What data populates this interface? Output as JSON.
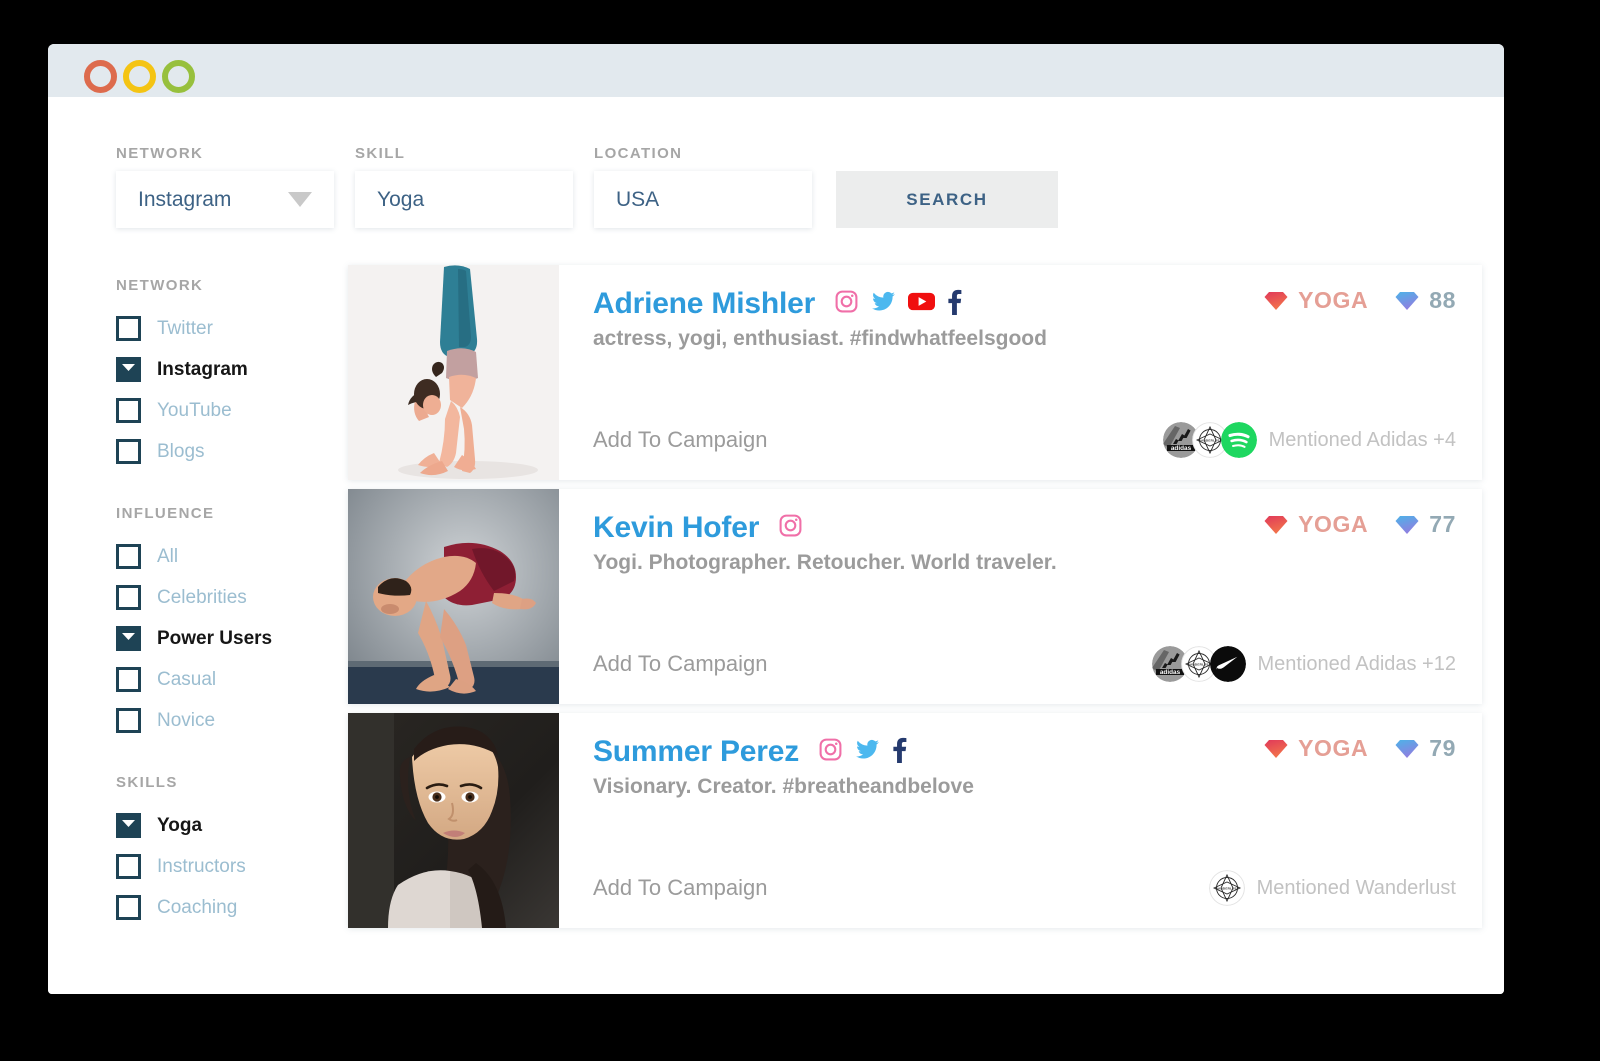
{
  "window": {
    "traffic_lights": [
      {
        "name": "close-button",
        "color": "#dd6b4d"
      },
      {
        "name": "minimize-button",
        "color": "#f4c413"
      },
      {
        "name": "maximize-button",
        "color": "#97c03d"
      }
    ]
  },
  "search": {
    "network": {
      "label": "NETWORK",
      "value": "Instagram"
    },
    "skill": {
      "label": "SKILL",
      "value": "Yoga",
      "placeholder": "Yoga"
    },
    "location": {
      "label": "LOCATION",
      "value": "USA",
      "placeholder": "USA"
    },
    "button_label": "SEARCH"
  },
  "sidebar": {
    "groups": [
      {
        "title": "NETWORK",
        "items": [
          {
            "label": "Twitter",
            "checked": false
          },
          {
            "label": "Instagram",
            "checked": true
          },
          {
            "label": "YouTube",
            "checked": false
          },
          {
            "label": "Blogs",
            "checked": false
          }
        ]
      },
      {
        "title": "INFLUENCE",
        "items": [
          {
            "label": "All",
            "checked": false
          },
          {
            "label": "Celebrities",
            "checked": false
          },
          {
            "label": "Power Users",
            "checked": true
          },
          {
            "label": "Casual",
            "checked": false
          },
          {
            "label": "Novice",
            "checked": false
          }
        ]
      },
      {
        "title": "SKILLS",
        "items": [
          {
            "label": "Yoga",
            "checked": true
          },
          {
            "label": "Instructors",
            "checked": false
          },
          {
            "label": "Coaching",
            "checked": false
          }
        ]
      }
    ]
  },
  "results": {
    "add_to_campaign_label": "Add To Campaign",
    "cards": [
      {
        "name": "Adriene Mishler",
        "bio": "actress, yogi, enthusiast. #findwhatfeelsgood",
        "socials": [
          "instagram-icon",
          "twitter-icon",
          "youtube-icon",
          "facebook-icon"
        ],
        "skill_badge": "YOGA",
        "score": "88",
        "brands": [
          "adidas-logo",
          "wanderlust-logo",
          "spotify-logo"
        ],
        "mention_text": "Mentioned Adidas +4",
        "thumb": "handstand-yoga-photo"
      },
      {
        "name": "Kevin Hofer",
        "bio": "Yogi. Photographer. Retoucher. World traveler.",
        "socials": [
          "instagram-icon"
        ],
        "skill_badge": "YOGA",
        "score": "77",
        "brands": [
          "adidas-logo",
          "wanderlust-logo",
          "nike-logo"
        ],
        "mention_text": "Mentioned Adidas +12",
        "thumb": "crow-pose-yoga-photo"
      },
      {
        "name": "Summer Perez",
        "bio": "Visionary. Creator. #breatheandbelove",
        "socials": [
          "instagram-icon",
          "twitter-icon",
          "facebook-icon"
        ],
        "skill_badge": "YOGA",
        "score": "79",
        "brands": [
          "wanderlust-logo"
        ],
        "mention_text": "Mentioned Wanderlust",
        "thumb": "portrait-selfie-photo"
      }
    ]
  },
  "colors": {
    "accent_blue": "#2e9bdc",
    "skill_badge": "#e59f95",
    "score_badge": "#93a9b4",
    "checkbox_navy": "#1e4355",
    "titlebar": "#e2e9ee"
  }
}
